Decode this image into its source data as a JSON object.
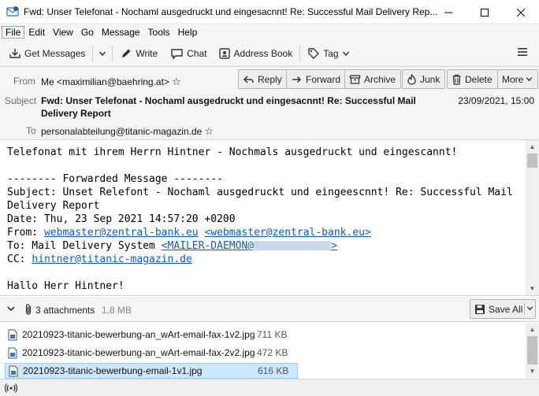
{
  "window": {
    "title": "Fwd: Unser Telefonat - Nochaml ausgedruckt und eingesacnnt! Re: Successful Mail Delivery Rep..."
  },
  "menu": [
    "File",
    "Edit",
    "View",
    "Go",
    "Message",
    "Tools",
    "Help"
  ],
  "toolbar": {
    "get_messages": "Get Messages",
    "write": "Write",
    "chat": "Chat",
    "address_book": "Address Book",
    "tag": "Tag"
  },
  "header": {
    "from_label": "From",
    "from_value": "Me <maximilian@baehring.at>",
    "subject_label": "Subject",
    "subject_value": "Fwd: Unser Telefonat - Nochaml ausgedruckt und eingesacnnt! Re: Successful Mail Delivery Report",
    "to_label": "To",
    "to_value": "personalabteilung@titanic-magazin.de",
    "date": "23/09/2021, 15:00",
    "actions": {
      "reply": "Reply",
      "forward": "Forward",
      "archive": "Archive",
      "junk": "Junk",
      "delete": "Delete",
      "more": "More"
    }
  },
  "body": {
    "line1": "Telefonat mit ihrem Herrn Hintner - Nochmals ausgedruckt und eingescannt!",
    "fwd_header": "-------- Forwarded Message --------",
    "subject_line": "Subject: Unset Relefont - Nochaml ausgedruckt und eingeescnnt! Re: Successful Mail Delivery Report",
    "date_line": "Date: Thu, 23 Sep 2021 14:57:20 +0200",
    "from_prefix": "From: ",
    "from_link": "webmaster@zentral-bank.eu",
    "from_link2": "<webmaster@zentral-bank.eu>",
    "to_prefix": "To: Mail Delivery System ",
    "to_link_start": "<MAILER-DAEMON@",
    "to_link_end": ">",
    "cc_prefix": "CC: ",
    "cc_link": "hintner@titanic-magazin.de",
    "greeting": "Hallo Herr Hintner!"
  },
  "attachments": {
    "count_label": "3 attachments",
    "total_size": "1,8 MB",
    "save_all": "Save All",
    "items": [
      {
        "name": "20210923-titanic-bewerbung-an_wArt-email-fax-1v2.jpg",
        "size": "711 KB"
      },
      {
        "name": "20210923-titanic-bewerbung-an_wArt-email-fax-2v2.jpg",
        "size": "472 KB"
      },
      {
        "name": "20210923-titanic-bewerbung-email-1v1.jpg",
        "size": "616 KB"
      }
    ]
  },
  "colors": {
    "link": "#0b5fb8",
    "selection": "#cce8ff",
    "chrome": "#f5f5f5"
  }
}
